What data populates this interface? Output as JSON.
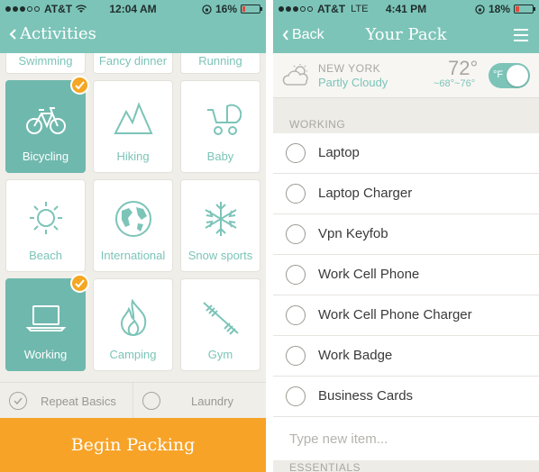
{
  "left_screen": {
    "status": {
      "carrier": "AT&T",
      "time": "12:04 AM",
      "battery": "16%",
      "battery_level": 0.16
    },
    "nav": {
      "back_label": "Activities"
    },
    "top_row": [
      "Swimming",
      "Fancy dinner",
      "Running"
    ],
    "tiles": [
      {
        "label": "Bicycling",
        "icon": "bicycle-icon",
        "selected": true
      },
      {
        "label": "Hiking",
        "icon": "mountains-icon",
        "selected": false
      },
      {
        "label": "Baby",
        "icon": "stroller-icon",
        "selected": false
      },
      {
        "label": "Beach",
        "icon": "sun-icon",
        "selected": false
      },
      {
        "label": "International",
        "icon": "globe-icon",
        "selected": false
      },
      {
        "label": "Snow sports",
        "icon": "snowflake-icon",
        "selected": false
      },
      {
        "label": "Working",
        "icon": "laptop-icon",
        "selected": true
      },
      {
        "label": "Camping",
        "icon": "flame-icon",
        "selected": false
      },
      {
        "label": "Gym",
        "icon": "dumbbell-icon",
        "selected": false
      }
    ],
    "options": {
      "repeat_basics": "Repeat Basics",
      "laundry": "Laundry"
    },
    "begin_button": "Begin Packing"
  },
  "right_screen": {
    "status": {
      "carrier": "AT&T",
      "network": "LTE",
      "time": "4:41 PM",
      "battery": "18%",
      "battery_level": 0.18
    },
    "nav": {
      "back_label": "Back",
      "title": "Your Pack"
    },
    "weather": {
      "city": "NEW YORK",
      "condition": "Partly Cloudy",
      "temp": "72°",
      "range": "~68°~76°",
      "unit": "°F"
    },
    "section_working": "WORKING",
    "items": [
      "Laptop",
      "Laptop Charger",
      "Vpn Keyfob",
      "Work Cell Phone",
      "Work Cell Phone Charger",
      "Work Badge",
      "Business Cards"
    ],
    "new_item_placeholder": "Type new item...",
    "section_essentials": "ESSENTIALS"
  },
  "colors": {
    "teal": "#7cc4b8",
    "selected_tile": "#6fb8ad",
    "orange": "#f7a328",
    "check_badge": "#f5a623"
  }
}
